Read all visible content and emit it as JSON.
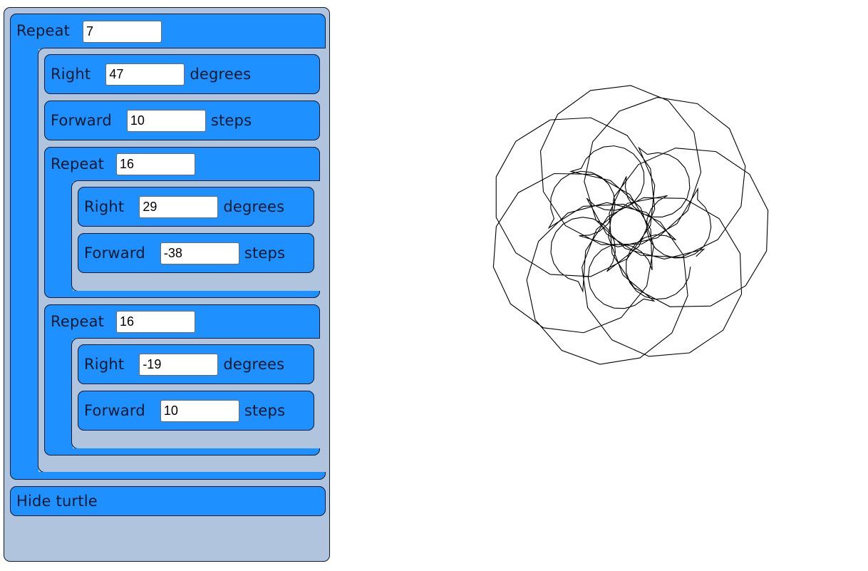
{
  "program": [
    {
      "type": "repeat",
      "label": "Repeat",
      "value": "7",
      "body": [
        {
          "type": "right",
          "label": "Right",
          "value": "47",
          "unit": "degrees"
        },
        {
          "type": "forward",
          "label": "Forward",
          "value": "10",
          "unit": "steps"
        },
        {
          "type": "repeat",
          "label": "Repeat",
          "value": "16",
          "body": [
            {
              "type": "right",
              "label": "Right",
              "value": "29",
              "unit": "degrees"
            },
            {
              "type": "forward",
              "label": "Forward",
              "value": "-38",
              "unit": "steps"
            }
          ]
        },
        {
          "type": "repeat",
          "label": "Repeat",
          "value": "16",
          "body": [
            {
              "type": "right",
              "label": "Right",
              "value": "-19",
              "unit": "degrees"
            },
            {
              "type": "forward",
              "label": "Forward",
              "value": "10",
              "unit": "steps"
            }
          ]
        }
      ]
    },
    {
      "type": "hide",
      "label": "Hide turtle"
    }
  ],
  "colors": {
    "block": "#1e90ff",
    "panel": "#b0c4de",
    "ink": "#000000"
  }
}
